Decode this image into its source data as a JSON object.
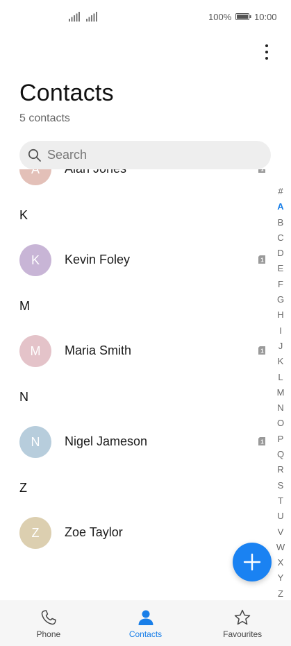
{
  "status_bar": {
    "battery": "100%",
    "time": "10:00"
  },
  "header": {
    "title": "Contacts",
    "count": "5 contacts"
  },
  "search": {
    "placeholder": "Search"
  },
  "contacts": {
    "alan": {
      "initial": "A",
      "name": "Alan Jones",
      "avatar_color": "#e3c0b8"
    },
    "k_header": "K",
    "kevin": {
      "initial": "K",
      "name": "Kevin Foley",
      "avatar_color": "#c8b5d6"
    },
    "m_header": "M",
    "maria": {
      "initial": "M",
      "name": "Maria Smith",
      "avatar_color": "#e4c3c9"
    },
    "n_header": "N",
    "nigel": {
      "initial": "N",
      "name": "Nigel Jameson",
      "avatar_color": "#b7cddc"
    },
    "z_header": "Z",
    "zoe": {
      "initial": "Z",
      "name": "Zoe Taylor",
      "avatar_color": "#dccfb0"
    }
  },
  "index_letters": [
    "#",
    "A",
    "B",
    "C",
    "D",
    "E",
    "F",
    "G",
    "H",
    "I",
    "J",
    "K",
    "L",
    "M",
    "N",
    "O",
    "P",
    "Q",
    "R",
    "S",
    "T",
    "U",
    "V",
    "W",
    "X",
    "Y",
    "Z"
  ],
  "index_active": "A",
  "bottom_nav": {
    "phone": "Phone",
    "contacts": "Contacts",
    "favourites": "Favourites"
  },
  "colors": {
    "accent": "#1a7fe8",
    "fab": "#1a82f2",
    "search_bg": "#eeeeee",
    "nav_bg": "#f6f6f6"
  },
  "icons": [
    "signal-icon",
    "battery-icon",
    "more-vert-icon",
    "search-icon",
    "sim-card-icon",
    "plus-icon",
    "phone-icon",
    "person-icon",
    "star-icon"
  ]
}
